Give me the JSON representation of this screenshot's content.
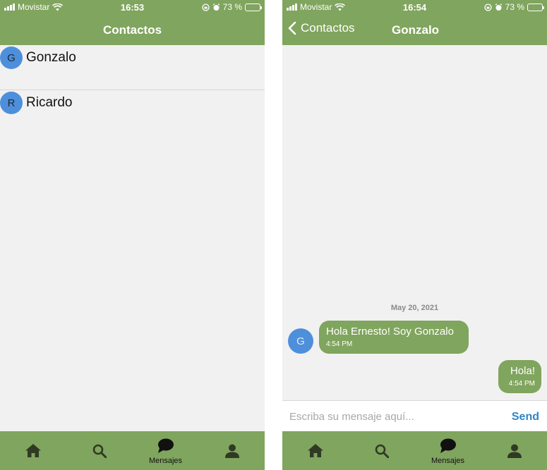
{
  "status_bar_left": {
    "carrier": "Movistar",
    "time": "16:53",
    "battery": "73 %",
    "battery_level": 0.73
  },
  "status_bar_right": {
    "carrier": "Movistar",
    "time": "16:54",
    "battery": "73 %",
    "battery_level": 0.73
  },
  "contacts_screen": {
    "title": "Contactos",
    "contacts": [
      {
        "initial": "G",
        "name": "Gonzalo"
      },
      {
        "initial": "R",
        "name": "Ricardo"
      }
    ]
  },
  "chat_screen": {
    "back_label": "Contactos",
    "title": "Gonzalo",
    "date": "May 20, 2021",
    "messages": [
      {
        "sender_initial": "G",
        "text": "Hola Ernesto! Soy Gonzalo",
        "time": "4:54 PM",
        "direction": "incoming"
      },
      {
        "text": "Hola!",
        "time": "4:54 PM",
        "direction": "outgoing"
      }
    ],
    "input_placeholder": "Escriba su mensaje aquí...",
    "send_label": "Send"
  },
  "tabbar": {
    "active_tab": "messages",
    "tabs": [
      {
        "icon": "home-icon",
        "label": ""
      },
      {
        "icon": "search-icon",
        "label": ""
      },
      {
        "icon": "chat-bubble-icon",
        "label": "Mensajes"
      },
      {
        "icon": "person-icon",
        "label": ""
      }
    ]
  },
  "colors": {
    "header": "#80a55e",
    "tabbar": "#80a55e",
    "bubble": "#80a55e",
    "avatar": "#4d8fdb",
    "background": "#f1f1f1",
    "send": "#2f86c9",
    "icon": "#2f3a24"
  }
}
